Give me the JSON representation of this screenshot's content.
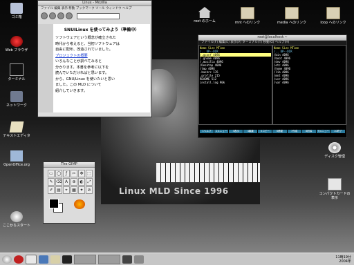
{
  "desktop_icons_left": [
    {
      "label": "ゴミ箱",
      "icon": "trash-icon"
    },
    {
      "label": "Web ブラウザ",
      "icon": "browser-icon"
    },
    {
      "label": "ターミナル",
      "icon": "terminal-icon"
    },
    {
      "label": "ネットワーク",
      "icon": "network-icon"
    },
    {
      "label": "テキストエディタ",
      "icon": "text-editor-icon"
    },
    {
      "label": "OpenOffice.org",
      "icon": "office-icon"
    },
    {
      "label": "ここからスタート",
      "icon": "start-here-icon"
    }
  ],
  "desktop_icons_top": [
    {
      "label": "root のホーム",
      "icon": "home-icon"
    },
    {
      "label": "mnt へのリンク",
      "icon": "folder-icon"
    },
    {
      "label": "media へのリンク",
      "icon": "folder-icon"
    },
    {
      "label": "loop へのリンク",
      "icon": "folder-icon"
    }
  ],
  "desktop_icons_right": [
    {
      "label": "ディスク管理",
      "icon": "disk-icon"
    },
    {
      "label": "コンパクトカードの表示",
      "icon": "card-icon"
    }
  ],
  "wallpaper": {
    "caption": "Linux MLD    Since 1996"
  },
  "browser": {
    "title": "Linux - Mozilla",
    "menu": "ファイル 編集 表示 移動 ブックマーク ツール ウィンドウ ヘルプ",
    "heading": "SNUILinux を使ってみよう（準備中）",
    "body_lines": [
      "ソフトウェアという概念が確立された",
      "時代から考えると、当初ソフトウェアは",
      "自由に配布、改造されていました。",
      "プロジェクトの概要 については",
      "いろんなことが調べてみると",
      "分かります。本書を参考に以下を",
      "読んでいただければと思います。",
      "から、GNU/Linux を使いたいと思い",
      "ました。この MLD について",
      "紹介していきます。"
    ],
    "link_text": "プロジェクトの概要"
  },
  "file_manager": {
    "title": "root@localhost:~",
    "menu": "ファイル(F) 編集(E) 表示(V) ターミナル(T) 移動(G) ヘルプ(H)",
    "left_header": "Name  Size  MTime",
    "right_header": "Name  Size  MTime",
    "left_rows": [
      "/..  UP--DIR",
      "/.gconf   4096",
      "/.gnome   4096",
      "/.mozilla 4096",
      "/Desktop  4096",
      "/tmp      4096",
      ".bashrc    176",
      ".profile   215",
      "README     512",
      "install.log 90k"
    ],
    "right_rows": [
      "/..  UP--DIR",
      "/bin      4096",
      "/boot     4096",
      "/dev      4096",
      "/etc      4096",
      "/home     4096",
      "/lib      4096",
      "/mnt      4096",
      "/usr      4096",
      "/var      4096"
    ],
    "fkeys": [
      "1ヘルプ",
      "2メニュー",
      "3表示",
      "4編集",
      "5コピー",
      "6移動",
      "7作成",
      "8削除",
      "9メニュー",
      "10終了"
    ]
  },
  "gimp": {
    "title": "The GIMP",
    "tools": [
      "▭",
      "◯",
      "ƒ",
      "✂",
      "✥",
      "⬚",
      "✎",
      "⌫",
      "A",
      "⊕",
      "◐",
      "⤢",
      "✐",
      "▤",
      "⌖",
      "▦",
      "✦",
      "⊘"
    ]
  },
  "taskbar": {
    "clock_line1": "11時19分",
    "clock_line2": "2004年"
  },
  "colors": {
    "accent": "#2a7a9c",
    "link": "#1c3fd0",
    "highlight": "#ffff80"
  }
}
